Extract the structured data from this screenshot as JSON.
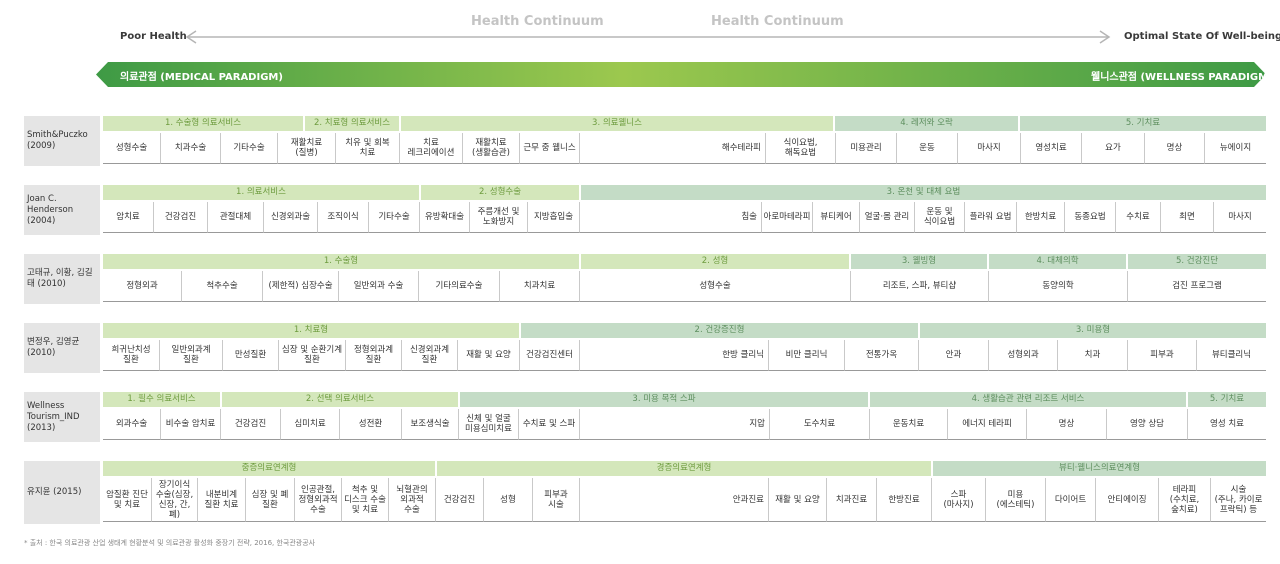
{
  "header": {
    "continuum_title_left": "Health Continuum",
    "continuum_title_right": "Health Continuum",
    "poor_health": "Poor Health",
    "optimal_state": "Optimal State Of Well-being",
    "medical_paradigm": "의료관점 (MEDICAL PARADIGM)",
    "wellness_paradigm": "웰니스관점 (WELLNESS PARADIGM)"
  },
  "colors": {
    "green_dark": "#3e9a45",
    "green_light": "#9cc84e",
    "category_light": "#d4e7bb",
    "category_mid": "#c4dcc6",
    "author_bg": "#e5e5e5"
  },
  "rows": [
    {
      "author": "Smith&Puczko\n(2009)",
      "categories": [
        {
          "label": "1. 수술형 의료서비스"
        },
        {
          "label": "2. 치료형 의료서비스"
        },
        {
          "label": "3. 의료웰니스"
        },
        {
          "label": "4. 레저와 오락"
        },
        {
          "label": "5. 기치료"
        }
      ],
      "items": [
        "성형수술",
        "치과수술",
        "기타수술",
        "재활치료\n(질병)",
        "치유 및 회복\n치료",
        "치료\n레크리에이션",
        "재활치료\n(생활습관)",
        "근무 중 웰니스",
        "해수테라피",
        "식이요법,\n해독요법",
        "미용관리",
        "운동",
        "마사지",
        "영성치료",
        "요가",
        "명상",
        "뉴에이지"
      ]
    },
    {
      "author": "Joan C.\nHenderson (2004)",
      "categories": [
        {
          "label": "1. 의료서비스"
        },
        {
          "label": "2. 성형수술"
        },
        {
          "label": "3. 온천 및 대체 요법"
        }
      ],
      "items": [
        "암치료",
        "건강검진",
        "관절대체",
        "신경외과술",
        "조직이식",
        "기타수술",
        "유방확대술",
        "주름개선 및\n노화방지",
        "지방흡입술",
        "침술",
        "아로마테라피",
        "뷰티케어",
        "얼굴·몸 관리",
        "운동 및\n식이요법",
        "플라워 요법",
        "한방치료",
        "동종요법",
        "수치료",
        "최면",
        "마사지"
      ]
    },
    {
      "author": "고태규, 이황,\n김길태 (2010)",
      "categories": [
        {
          "label": "1. 수술형"
        },
        {
          "label": "2. 성형"
        },
        {
          "label": "3. 웰빙형"
        },
        {
          "label": "4. 대체의학"
        },
        {
          "label": "5. 건강진단"
        }
      ],
      "items": [
        "정형외과",
        "척추수술",
        "(제한적) 심장수술",
        "일반외과 수술",
        "기타의료수술",
        "치과치료",
        "성형수술",
        "리조트, 스파, 뷰티샵",
        "동양의학",
        "검진 프로그램"
      ]
    },
    {
      "author": "변정우, 김영균\n(2010)",
      "categories": [
        {
          "label": "1. 치료형"
        },
        {
          "label": "2. 건강증진형"
        },
        {
          "label": "3. 미용형"
        }
      ],
      "items": [
        "희귀난치성\n질환",
        "일반외과계\n질환",
        "만성질환",
        "심장 및 순환기계\n질환",
        "정형외과계\n질환",
        "신경외과계\n질환",
        "재활 및 요양",
        "건강검진센터",
        "한방 클리닉",
        "비만 클리닉",
        "전통가옥",
        "안과",
        "성형외과",
        "치과",
        "피부과",
        "뷰티클리닉"
      ]
    },
    {
      "author": "Wellness\nTourism_IND\n(2013)",
      "categories": [
        {
          "label": "1. 필수 의료서비스"
        },
        {
          "label": "2. 선택 의료서비스"
        },
        {
          "label": "3. 미용 목적 스파"
        },
        {
          "label": "4. 생활습관 관련 리조트 서비스"
        },
        {
          "label": "5. 기치료"
        }
      ],
      "items": [
        "외과수술",
        "비수술 암치료",
        "건강검진",
        "심미치료",
        "성전환",
        "보조생식술",
        "신체 및 얼굴\n미용심미치료",
        "수치료 및 스파",
        "지압",
        "도수치료",
        "운동치료",
        "에너지 테라피",
        "명상",
        "영양 상담",
        "영성 치료"
      ]
    },
    {
      "author": "유지윤 (2015)",
      "categories": [
        {
          "label": "중증의료연계형"
        },
        {
          "label": "경증의료연계형"
        },
        {
          "label": "뷰티·웰니스의료연계형"
        }
      ],
      "items": [
        "암질환 진단\n및 치료",
        "장기이식\n수술(심장,\n신장, 간, 폐)",
        "내분비계\n질환 치료",
        "심장 및 폐\n질환",
        "인공관절,\n정형외과적\n수술",
        "척추 및\n디스크 수술\n및 치료",
        "뇌혈관의\n외과적\n수술",
        "건강검진",
        "성형",
        "피부과\n시술",
        "안과진료",
        "재활 및 요양",
        "치과진료",
        "한방진료",
        "스파\n(마사지)",
        "미용\n(에스테틱)",
        "다이어트",
        "안티에이징",
        "테라피\n(수치료,\n숲치료)",
        "시술\n(주나, 카이로\n프락틱) 등"
      ]
    }
  ],
  "footnote": "* 출처 : 한국 의료관광 산업 생태계 현황분석 및 의료관광 활성화 중장기 전략, 2016, 한국관광공사"
}
